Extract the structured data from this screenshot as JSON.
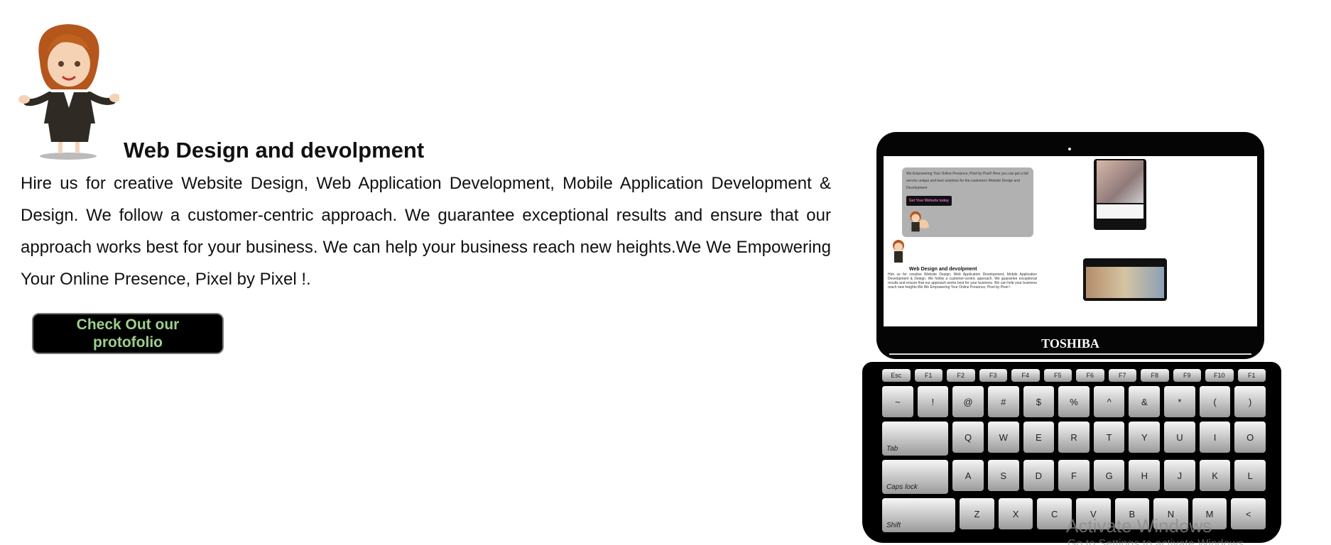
{
  "hero": {
    "title": "Web Design and devolpment",
    "description": "Hire us for creative Website Design, Web Application Development, Mobile Application Development & Design. We follow a customer-centric approach. We guarantee exceptional results and ensure that our approach works best for your business. We can help your business reach new heights.We We Empowering Your Online Presence, Pixel by Pixel !.",
    "cta_label": "Check Out our protofolio"
  },
  "laptop": {
    "brand": "TOSHIBA",
    "screen": {
      "card_text": "We Empowering Your Online Presence, Pixel by Pixel! Here you can get a full service unique and best solutions for the customers Website Design and Development",
      "card_button": "Get Your Website today",
      "mini_title": "Web Design and devolpment",
      "mini_text": "Hire us for creative Website Design, Web Application Development, Mobile Application Development & Design. We follow a customer-centric approach. We guarantee exceptional results and ensure that our approach works best for your business. We can help your business reach new heights.We We Empowering Your Online Presence, Pixel by Pixel !."
    },
    "keyboard": {
      "fn_row": [
        "Esc",
        "F1",
        "F2",
        "F3",
        "F4",
        "F5",
        "F6",
        "F7",
        "F8",
        "F9",
        "F10",
        "F1"
      ],
      "num_row": [
        "~",
        "!",
        "@",
        "#",
        "$",
        "%",
        "^",
        "&",
        "*",
        "(",
        ")"
      ],
      "tab_row": [
        "Tab",
        "Q",
        "W",
        "E",
        "R",
        "T",
        "Y",
        "U",
        "I",
        "O"
      ],
      "caps_row": [
        "Caps lock",
        "A",
        "S",
        "D",
        "F",
        "G",
        "H",
        "J",
        "K",
        "L"
      ],
      "shift_row": [
        "Shift",
        "Z",
        "X",
        "C",
        "V",
        "B",
        "N",
        "M",
        "<"
      ]
    }
  },
  "watermark": {
    "title": "Activate Windows",
    "subtitle": "Go to Settings to activate Windows."
  }
}
